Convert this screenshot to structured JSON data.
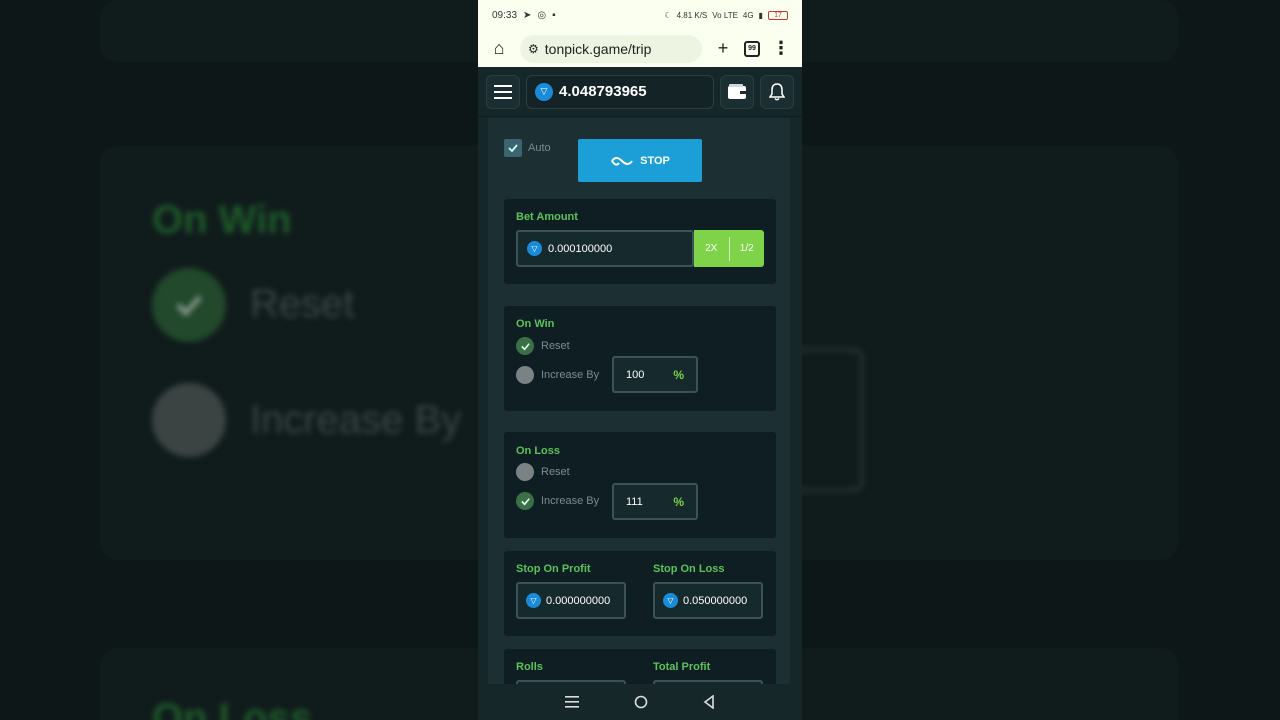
{
  "backdrop": {
    "on_win": "On Win",
    "reset": "Reset",
    "increase_by": "Increase By",
    "on_loss": "On Loss"
  },
  "status": {
    "time": "09:33",
    "speed": "4.81 K/S",
    "network": "Vo LTE",
    "signal": "4G",
    "battery": "17"
  },
  "browser": {
    "url": "tonpick.game/trip",
    "tab_count": "99"
  },
  "header": {
    "balance": "4.048793965"
  },
  "controls": {
    "auto_label": "Auto",
    "stop_label": "STOP"
  },
  "bet": {
    "label": "Bet Amount",
    "value": "0.000100000",
    "double_label": "2X",
    "half_label": "1/2"
  },
  "on_win": {
    "label": "On Win",
    "reset_label": "Reset",
    "increase_label": "Increase By",
    "increase_value": "100",
    "unit": "%"
  },
  "on_loss": {
    "label": "On Loss",
    "reset_label": "Reset",
    "increase_label": "Increase By",
    "increase_value": "111",
    "unit": "%"
  },
  "stops": {
    "profit_label": "Stop On Profit",
    "profit_value": "0.000000000",
    "loss_label": "Stop On Loss",
    "loss_value": "0.050000000"
  },
  "stats": {
    "rolls_label": "Rolls",
    "total_profit_label": "Total Profit"
  },
  "colors": {
    "accent_blue": "#1b9fd6",
    "accent_green": "#7ed348",
    "label_green": "#5cc25c"
  }
}
